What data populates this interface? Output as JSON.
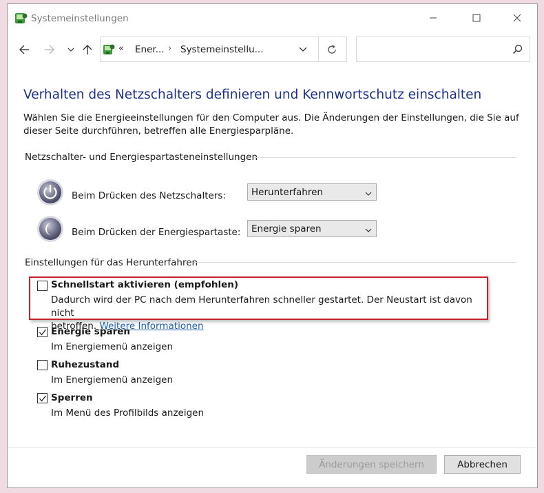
{
  "window": {
    "title": "Systemeinstellungen"
  },
  "nav": {
    "crumbs_prefix": "«",
    "crumb1": "Ener...",
    "crumb_sep": "›",
    "crumb2": "Systemeinstellu...",
    "search_placeholder": ""
  },
  "page": {
    "heading": "Verhalten des Netzschalters definieren und Kennwortschutz einschalten",
    "intro": "Wählen Sie die Energieeinstellungen für den Computer aus. Die Änderungen der Einstellungen, die Sie auf dieser Seite durchführen, betreffen alle Energiesparpläne."
  },
  "buttons_section": {
    "label": "Netzschalter- und Energiespartasteneinstellungen",
    "power_button": {
      "label": "Beim Drücken des Netzschalters:",
      "value": "Herunterfahren"
    },
    "sleep_button": {
      "label": "Beim Drücken der Energiespartaste:",
      "value": "Energie sparen"
    }
  },
  "shutdown_section": {
    "label": "Einstellungen für das Herunterfahren",
    "items": [
      {
        "title": "Schnellstart aktivieren (empfohlen)",
        "desc_line1": "Dadurch wird der PC nach dem Herunterfahren schneller gestartet. Der Neustart ist davon nicht",
        "desc_line2_prefix": "betroffen.",
        "link": "Weitere Informationen",
        "checked": false
      },
      {
        "title": "Energie sparen",
        "desc": "Im Energiemenü anzeigen",
        "checked": true
      },
      {
        "title": "Ruhezustand",
        "desc": "Im Energiemenü anzeigen",
        "checked": false
      },
      {
        "title": "Sperren",
        "desc": "Im Menü des Profilbilds anzeigen",
        "checked": true
      }
    ]
  },
  "footer": {
    "save_label": "Änderungen speichern",
    "cancel_label": "Abbrechen"
  },
  "colors": {
    "heading": "#1e3287",
    "link": "#1a5fb4",
    "highlight_border": "#c8202a"
  }
}
